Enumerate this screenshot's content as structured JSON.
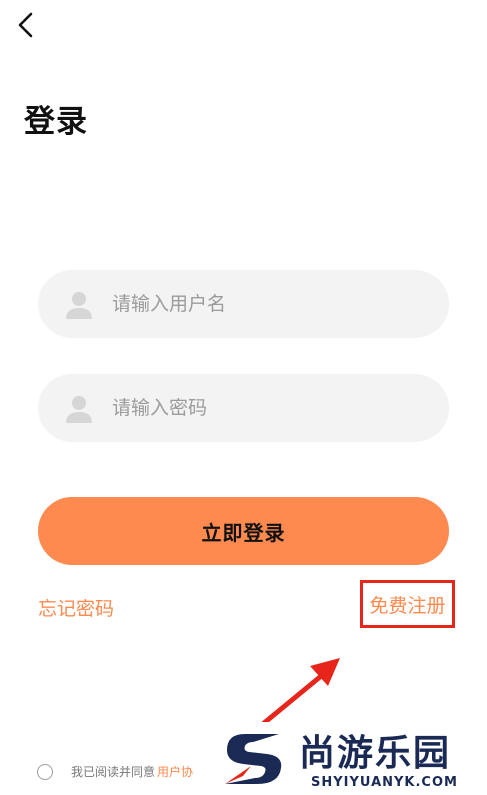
{
  "header": {
    "back_icon": "chevron-left-icon",
    "title": "登录"
  },
  "form": {
    "username": {
      "placeholder": "请输入用户名",
      "value": "",
      "icon": "user-icon"
    },
    "password": {
      "placeholder": "请输入密码",
      "value": "",
      "icon": "user-icon"
    },
    "submit_label": "立即登录"
  },
  "links": {
    "forgot": "忘记密码",
    "register": "免费注册"
  },
  "agreement": {
    "text": "我已阅读并同意",
    "link": "用户协"
  },
  "watermark": {
    "title": "尚游乐园",
    "subtitle": "SHYIYUANYK.COM"
  },
  "colors": {
    "accent": "#ff8a4f",
    "field_bg": "#f3f3f3",
    "highlight": "#e8251b",
    "watermark": "#1a2a55"
  }
}
